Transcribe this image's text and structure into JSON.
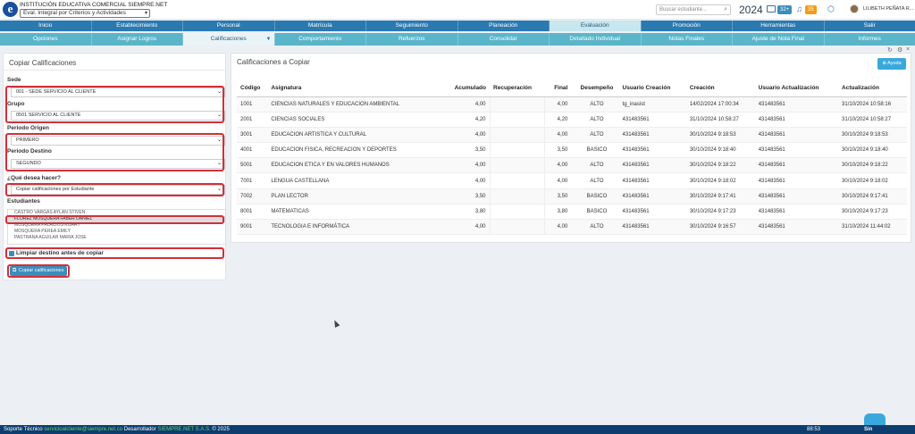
{
  "header": {
    "school_name": "INSTITUCIÓN EDUCATIVA COMERCIAL SIEMPRE.NET",
    "eval_select": "Eval. Integral por Criterios y Actividades",
    "search_placeholder": "Buscar estudiante...",
    "year": "2024",
    "mail_badge": "32+",
    "bell_badge": "35",
    "user_name": "LILIBETH PEÑATA R..."
  },
  "nav": [
    "Inicio",
    "Establecimiento",
    "Personal",
    "Matrícula",
    "Seguimiento",
    "Planeación",
    "Evaluación",
    "Promoción",
    "Herramientas",
    "Salir"
  ],
  "nav_active": 6,
  "subnav": [
    "Opciones",
    "Asignar Logros",
    "Calificaciones",
    "Comportamiento",
    "Refuerzos",
    "Consolidar",
    "Detallado Individual",
    "Notas Finales",
    "Ajuste de Nota Final",
    "Informes"
  ],
  "subnav_active": 2,
  "left_panel": {
    "title": "Copiar Calificaciones",
    "sede_label": "Sede",
    "sede_value": "001 - SEDE SERVICIO AL CLIENTE",
    "grupo_label": "Grupo",
    "grupo_value": "0501 SERVICIO AL CLIENTE",
    "periodo_origen_label": "Periodo Origen",
    "periodo_origen_value": "PRIMERO",
    "periodo_destino_label": "Periodo Destino",
    "periodo_destino_value": "SEGUNDO",
    "que_desea_label": "¿Qué desea hacer?",
    "que_desea_value": "Copiar calificaciones por Estudiante",
    "estudiantes_label": "Estudiantes",
    "students": [
      "CASTRO VARGAS AYLAN STIVEN",
      "FLOREZ MOSQUERA FABER DANIEL",
      "MOSQUERA PALACIOS KIJARY",
      "MOSQUERA PEREA EMILY",
      "PASTRANA AGUILAR MARIA JOSE"
    ],
    "selected_student": 1,
    "limpiar_label": "Limpiar destino antes de copiar",
    "copy_button": "Copiar calificaciones"
  },
  "right_panel": {
    "title": "Calificaciones a Copiar",
    "help_button": "Ayuda",
    "columns": [
      "Código",
      "Asignatura",
      "Acumulado",
      "Recuperación",
      "Final",
      "Desempeño",
      "Usuario Creación",
      "Creación",
      "Usuario Actualización",
      "Actualización"
    ],
    "rows": [
      [
        "1001",
        "CIENCIAS NATURALES Y EDUCACION AMBIENTAL",
        "4,00",
        "",
        "4,00",
        "ALTO",
        "tg_inasist",
        "14/02/2024 17:00:34",
        "431483561",
        "31/10/2024 10:58:16"
      ],
      [
        "2001",
        "CIENCIAS SOCIALES",
        "4,20",
        "",
        "4,20",
        "ALTO",
        "431483561",
        "31/10/2024 10:58:27",
        "431483561",
        "31/10/2024 10:58:27"
      ],
      [
        "3001",
        "EDUCACION ARTISTICA Y CULTURAL",
        "4,00",
        "",
        "4,00",
        "ALTO",
        "431483561",
        "30/10/2024 9:18:53",
        "431483561",
        "30/10/2024 9:18:53"
      ],
      [
        "4001",
        "EDUCACION FISICA, RECREACION Y DEPORTES",
        "3,50",
        "",
        "3,50",
        "BASICO",
        "431483561",
        "30/10/2024 9:18:40",
        "431483561",
        "30/10/2024 9:18:40"
      ],
      [
        "5001",
        "EDUCACION ETICA Y EN VALORES HUMANOS",
        "4,00",
        "",
        "4,00",
        "ALTO",
        "431483561",
        "30/10/2024 9:18:22",
        "431483561",
        "30/10/2024 9:18:22"
      ],
      [
        "7001",
        "LENGUA CASTELLANA",
        "4,00",
        "",
        "4,00",
        "ALTO",
        "431483561",
        "30/10/2024 9:18:02",
        "431483561",
        "30/10/2024 9:18:02"
      ],
      [
        "7002",
        "PLAN LECTOR",
        "3,50",
        "",
        "3,50",
        "BASICO",
        "431483561",
        "30/10/2024 9:17:41",
        "431483561",
        "30/10/2024 9:17:41"
      ],
      [
        "8001",
        "MATEMATICAS",
        "3,80",
        "",
        "3,80",
        "BASICO",
        "431483561",
        "30/10/2024 9:17:23",
        "431483561",
        "30/10/2024 9:17:23"
      ],
      [
        "9001",
        "TECNOLOGIA E INFORMÁTICA",
        "4,00",
        "",
        "4,00",
        "ALTO",
        "431483561",
        "30/10/2024 9:16:57",
        "431483561",
        "31/10/2024 11:44:02"
      ]
    ]
  },
  "footer": {
    "soporte": "Soporte Técnico",
    "email": "servicioalcliente@siempre.net.co",
    "desarrollador": "Desarrollador",
    "company": "SIEMPRE.NET S.A.S.",
    "year": "© 2025",
    "clock": "88:53",
    "sin_label": "Sin"
  }
}
